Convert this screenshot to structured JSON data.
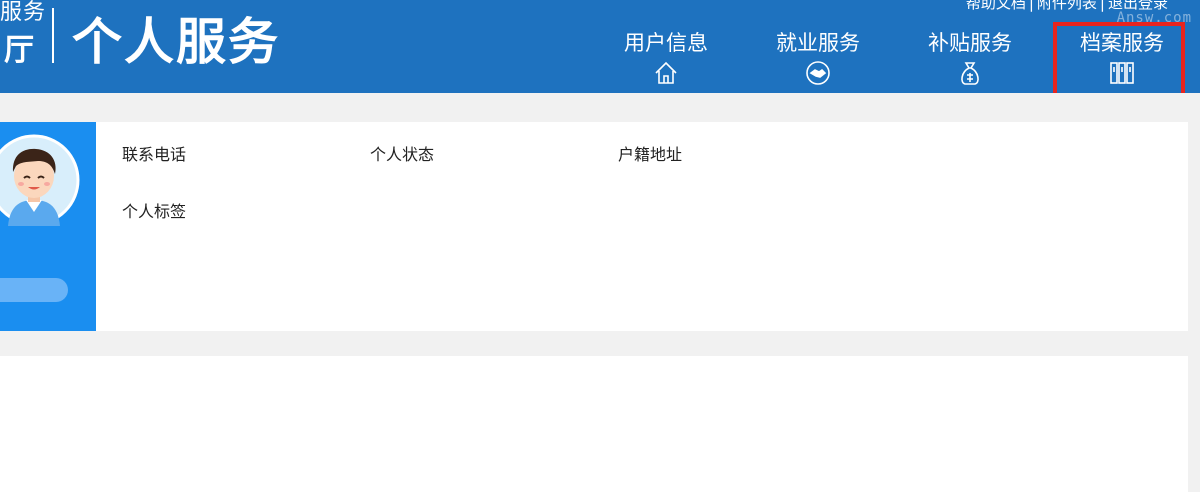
{
  "header": {
    "logo_small_top": "服务",
    "logo_small_bottom": "厅",
    "title": "个人服务",
    "top_links": [
      "帮助文档",
      "附件列表",
      "退出登录"
    ],
    "top_link_separator": "|",
    "watermark": "Answ.com",
    "nav": [
      {
        "label": "用户信息",
        "icon": "home-icon"
      },
      {
        "label": "就业服务",
        "icon": "handshake-icon"
      },
      {
        "label": "补贴服务",
        "icon": "money-bag-icon"
      },
      {
        "label": "档案服务",
        "icon": "archive-binders-icon"
      }
    ],
    "highlighted_nav": "档案服务",
    "colors": {
      "header_bg": "#1e72bf",
      "highlight": "#e8241f"
    }
  },
  "profile": {
    "fields": {
      "phone_label": "联系电话",
      "status_label": "个人状态",
      "address_label": "户籍地址",
      "tags_label": "个人标签"
    },
    "colors": {
      "side_bg": "#1a8ef0",
      "pill": "#69b3f7"
    }
  }
}
